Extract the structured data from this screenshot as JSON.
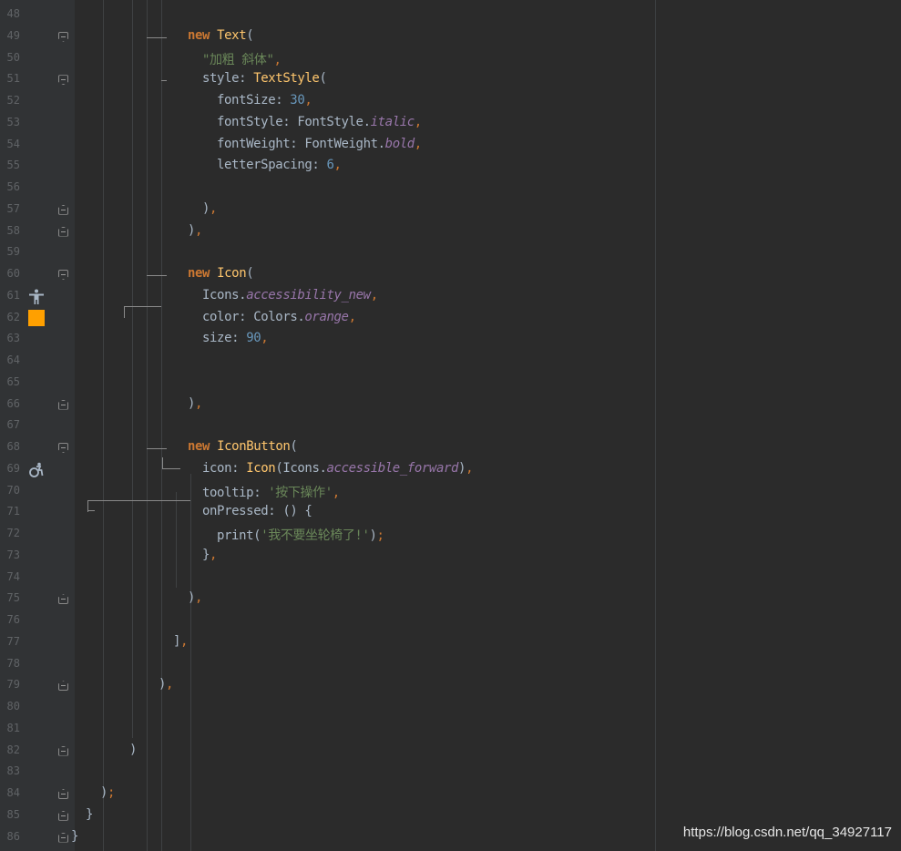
{
  "editor": {
    "lines": [
      {
        "no": "48",
        "indent": 0,
        "tokens": []
      },
      {
        "no": "49",
        "indent": 8,
        "fold": "top",
        "tokens": [
          {
            "t": "new ",
            "c": "kw"
          },
          {
            "t": "Text",
            "c": "cls"
          },
          {
            "t": "(",
            "c": ""
          }
        ]
      },
      {
        "no": "50",
        "indent": 9,
        "tokens": [
          {
            "t": "\"加粗 斜体\"",
            "c": "str"
          },
          {
            "t": ",",
            "c": "punc"
          }
        ]
      },
      {
        "no": "51",
        "indent": 9,
        "fold": "top",
        "tokens": [
          {
            "t": "style: ",
            "c": ""
          },
          {
            "t": "TextStyle",
            "c": "cls"
          },
          {
            "t": "(",
            "c": ""
          }
        ]
      },
      {
        "no": "52",
        "indent": 10,
        "tokens": [
          {
            "t": "fontSize: ",
            "c": ""
          },
          {
            "t": "30",
            "c": "num"
          },
          {
            "t": ",",
            "c": "punc"
          }
        ]
      },
      {
        "no": "53",
        "indent": 10,
        "tokens": [
          {
            "t": "fontStyle: FontStyle.",
            "c": ""
          },
          {
            "t": "italic",
            "c": "prop"
          },
          {
            "t": ",",
            "c": "punc"
          }
        ]
      },
      {
        "no": "54",
        "indent": 10,
        "tokens": [
          {
            "t": "fontWeight: FontWeight.",
            "c": ""
          },
          {
            "t": "bold",
            "c": "prop"
          },
          {
            "t": ",",
            "c": "punc"
          }
        ]
      },
      {
        "no": "55",
        "indent": 10,
        "tokens": [
          {
            "t": "letterSpacing: ",
            "c": ""
          },
          {
            "t": "6",
            "c": "num"
          },
          {
            "t": ",",
            "c": "punc"
          }
        ]
      },
      {
        "no": "56",
        "indent": 0,
        "tokens": []
      },
      {
        "no": "57",
        "indent": 9,
        "fold": "bot",
        "tokens": [
          {
            "t": ")",
            "c": ""
          },
          {
            "t": ",",
            "c": "punc"
          }
        ]
      },
      {
        "no": "58",
        "indent": 8,
        "fold": "bot",
        "tokens": [
          {
            "t": ")",
            "c": ""
          },
          {
            "t": ",",
            "c": "punc"
          }
        ]
      },
      {
        "no": "59",
        "indent": 0,
        "tokens": []
      },
      {
        "no": "60",
        "indent": 8,
        "fold": "top",
        "tokens": [
          {
            "t": "new ",
            "c": "kw"
          },
          {
            "t": "Icon",
            "c": "cls"
          },
          {
            "t": "(",
            "c": ""
          }
        ]
      },
      {
        "no": "61",
        "indent": 9,
        "icon": "accessibility-new-icon",
        "tokens": [
          {
            "t": "Icons.",
            "c": ""
          },
          {
            "t": "accessibility_new",
            "c": "prop"
          },
          {
            "t": ",",
            "c": "punc"
          }
        ]
      },
      {
        "no": "62",
        "indent": 9,
        "swatch": true,
        "tokens": [
          {
            "t": "color: Colors.",
            "c": ""
          },
          {
            "t": "orange",
            "c": "prop"
          },
          {
            "t": ",",
            "c": "punc"
          }
        ]
      },
      {
        "no": "63",
        "indent": 9,
        "tokens": [
          {
            "t": "size: ",
            "c": ""
          },
          {
            "t": "90",
            "c": "num"
          },
          {
            "t": ",",
            "c": "punc"
          }
        ]
      },
      {
        "no": "64",
        "indent": 0,
        "tokens": []
      },
      {
        "no": "65",
        "indent": 0,
        "tokens": []
      },
      {
        "no": "66",
        "indent": 8,
        "fold": "bot",
        "tokens": [
          {
            "t": ")",
            "c": ""
          },
          {
            "t": ",",
            "c": "punc"
          }
        ]
      },
      {
        "no": "67",
        "indent": 0,
        "tokens": []
      },
      {
        "no": "68",
        "indent": 8,
        "fold": "top",
        "tokens": [
          {
            "t": "new ",
            "c": "kw"
          },
          {
            "t": "IconButton",
            "c": "cls"
          },
          {
            "t": "(",
            "c": ""
          }
        ]
      },
      {
        "no": "69",
        "indent": 9,
        "icon": "accessible-forward-icon",
        "tokens": [
          {
            "t": "icon: ",
            "c": ""
          },
          {
            "t": "Icon",
            "c": "cls"
          },
          {
            "t": "(Icons.",
            "c": ""
          },
          {
            "t": "accessible_forward",
            "c": "prop"
          },
          {
            "t": ")",
            "c": ""
          },
          {
            "t": ",",
            "c": "punc"
          }
        ]
      },
      {
        "no": "70",
        "indent": 9,
        "tokens": [
          {
            "t": "tooltip: ",
            "c": ""
          },
          {
            "t": "'按下操作'",
            "c": "str"
          },
          {
            "t": ",",
            "c": "punc"
          }
        ]
      },
      {
        "no": "71",
        "indent": 9,
        "tokens": [
          {
            "t": "onPressed: () {",
            "c": ""
          }
        ]
      },
      {
        "no": "72",
        "indent": 10,
        "tokens": [
          {
            "t": "print(",
            "c": ""
          },
          {
            "t": "'我不要坐轮椅了!'",
            "c": "str"
          },
          {
            "t": ")",
            "c": ""
          },
          {
            "t": ";",
            "c": "punc"
          }
        ]
      },
      {
        "no": "73",
        "indent": 9,
        "tokens": [
          {
            "t": "}",
            "c": ""
          },
          {
            "t": ",",
            "c": "punc"
          }
        ]
      },
      {
        "no": "74",
        "indent": 0,
        "tokens": []
      },
      {
        "no": "75",
        "indent": 8,
        "fold": "bot",
        "tokens": [
          {
            "t": ")",
            "c": ""
          },
          {
            "t": ",",
            "c": "punc"
          }
        ]
      },
      {
        "no": "76",
        "indent": 0,
        "tokens": []
      },
      {
        "no": "77",
        "indent": 7,
        "tokens": [
          {
            "t": "]",
            "c": ""
          },
          {
            "t": ",",
            "c": "punc"
          }
        ]
      },
      {
        "no": "78",
        "indent": 0,
        "tokens": []
      },
      {
        "no": "79",
        "indent": 6,
        "fold": "bot",
        "tokens": [
          {
            "t": ")",
            "c": ""
          },
          {
            "t": ",",
            "c": "punc"
          }
        ]
      },
      {
        "no": "80",
        "indent": 0,
        "tokens": []
      },
      {
        "no": "81",
        "indent": 0,
        "tokens": []
      },
      {
        "no": "82",
        "indent": 4,
        "fold": "bot",
        "tokens": [
          {
            "t": ")",
            "c": ""
          }
        ]
      },
      {
        "no": "83",
        "indent": 0,
        "tokens": []
      },
      {
        "no": "84",
        "indent": 2,
        "fold": "bot",
        "tokens": [
          {
            "t": ")",
            "c": ""
          },
          {
            "t": ";",
            "c": "punc"
          }
        ]
      },
      {
        "no": "85",
        "indent": 1,
        "fold": "bot",
        "tokens": [
          {
            "t": "}",
            "c": ""
          }
        ]
      },
      {
        "no": "86",
        "indent": 0,
        "fold": "bot",
        "tokens": [
          {
            "t": "}",
            "c": ""
          }
        ]
      }
    ]
  },
  "watermark": "https://blog.csdn.net/qq_34927117",
  "colors": {
    "background": "#2b2b2b",
    "keyword": "#cc7832",
    "class": "#ffc66d",
    "string": "#6a8759",
    "number": "#6897bb",
    "property": "#9876aa",
    "text": "#a9b7c6",
    "orange_swatch": "#ffa000"
  }
}
